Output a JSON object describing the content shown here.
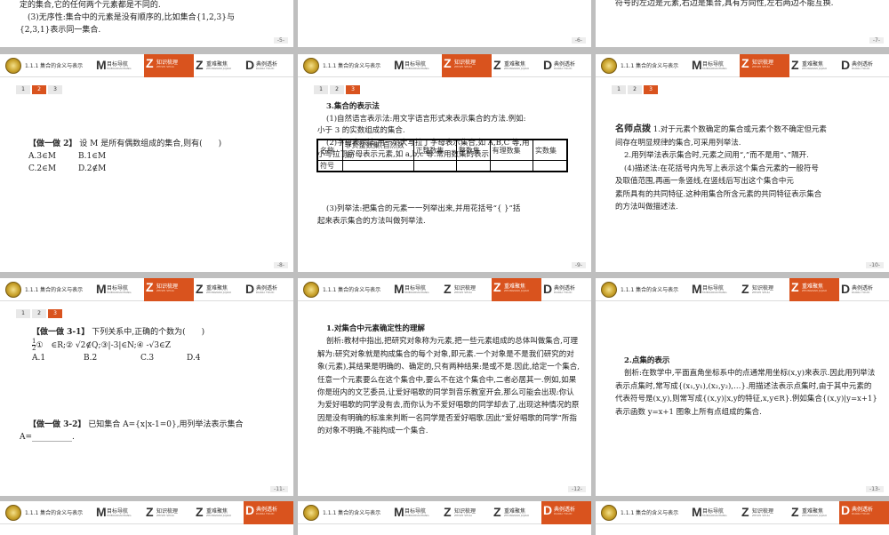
{
  "header": {
    "section": "1.1.1   集合的含义与表示",
    "nav": [
      {
        "letter": "M",
        "cn": "目标导航",
        "en": "MUBIAODAOHANG"
      },
      {
        "letter": "Z",
        "cn": "知识梳理",
        "en": "ZHISHI SHULI"
      },
      {
        "letter": "Z",
        "cn": "重难聚焦",
        "en": "ZHONGNAN JUJIAO"
      },
      {
        "letter": "D",
        "cn": "典例透析",
        "en": "DIANLI TOUXI"
      }
    ]
  },
  "tabs": [
    "1",
    "2",
    "3"
  ],
  "slides": {
    "s5": {
      "page": "-5-",
      "line1": "定的集合,它的任何两个元素都是不同的.",
      "line2": "(3)无序性:集合中的元素是没有顺序的,比如集合{1,2,3}与",
      "line3": "{2,3,1}表示同一集合."
    },
    "s6": {
      "page": "-6-"
    },
    "s7": {
      "page": "-7-",
      "line1": "符号的左边是元素,右边是集合,具有方向性,左右两边不能互换."
    },
    "s8": {
      "page": "-8-",
      "title": "【做一做 2】",
      "question": "设 M 是所有偶数组成的集合,则有(　　)",
      "optA": "A.3∈M",
      "optB": "B.1∈M",
      "optC": "C.2∈M",
      "optD": "D.2∉M"
    },
    "s9": {
      "page": "-9-",
      "heading": "3.集合的表示法",
      "p1": "(1)自然语言表示法:用文字语言形式来表示集合的方法.例如:",
      "p1b": "小于 3 的实数组成的集合.",
      "p2": "(2)字母表示法:用一个大写拉丁字母表示集合,如 A,B,C 等,用",
      "p2b": "小写拉丁字母表示元素,如 a,b,c 等.常用数集的表示:",
      "table_header": [
        "名称",
        "非负整数集(自然数集)",
        "正整数集",
        "整数集",
        "有理数集",
        "实数集"
      ],
      "table_row": [
        "符号",
        "",
        "",
        "",
        "",
        ""
      ],
      "p3": "(3)列举法:把集合的元素一一列举出来,并用花括号“{ }”括",
      "p3b": "起来表示集合的方法叫做列举法."
    },
    "s10": {
      "page": "-10-",
      "tip_title": "名师点拨",
      "tip1": "1.对于元素个数确定的集合或元素个数不确定但元素",
      "tip1b": "间存在明显规律的集合,可采用列举法.",
      "tip2": "2.用列举法表示集合时,元素之间用“,”而不是用“、”隔开.",
      "tip4": "(4)描述法:在花括号内先写上表示这个集合元素的一般符号",
      "tip4b": "及取值范围,再画一条竖线,在竖线后写出这个集合中元",
      "tip4c": "素所具有的共同特征.这种用集合所含元素的共同特征表示集合",
      "tip4d": "的方法叫做描述法."
    },
    "s11": {
      "page": "-11-",
      "title1": "【做一做 3-1】",
      "q1": "下列关系中,正确的个数为(　　)",
      "q1items": "①　∈R;② √2∉Q;③|-3|∈N;④ -√3∈Z",
      "frac_n": "1",
      "frac_d": "2",
      "optA": "A.1",
      "optB": "B.2",
      "optC": "C.3",
      "optD": "D.4",
      "title2": "【做一做 3-2】",
      "q2": "已知集合 A={x|x-1=0},用列举法表示集合",
      "q2b": "A=__________."
    },
    "s12": {
      "page": "-12-",
      "heading": "1.对集合中元素确定性的理解",
      "body": "剖析:教材中指出,把研究对象称为元素,把一些元素组成的总体叫做集合,可理解为:研究对象就是构成集合的每个对象,即元素.一个对象是不是我们研究的对象(元素),其结果是明确的、确定的,只有两种结果:是或不是.因此,给定一个集合,任意一个元素要么在这个集合中,要么不在这个集合中,二者必居其一.例如,如果你是班内的文艺委员,让爱好唱歌的同学到音乐教室开会,那么可能会出现:你认为爱好唱歌的同学没有去,而你认为不爱好唱歌的同学却去了,出现这种情况的原因是没有明确的标准来判断一名同学是否爱好唱歌.因此“爱好唱歌的同学”所指的对象不明确,不能构成一个集合."
    },
    "s13": {
      "page": "-13-",
      "heading": "2.点集的表示",
      "body": "剖析:在数学中,平面直角坐标系中的点通常用坐标(x,y)来表示.因此用列举法表示点集时,常写成{(x₁,y₁),(x₂,y₂),…}.用描述法表示点集时,由于其中元素的代表符号是(x,y),则常写成{(x,y)|x,y的特征,x,y∈R}.例如集合{(x,y)|y=x+1}表示函数 y=x+1 图象上所有点组成的集合."
    }
  }
}
